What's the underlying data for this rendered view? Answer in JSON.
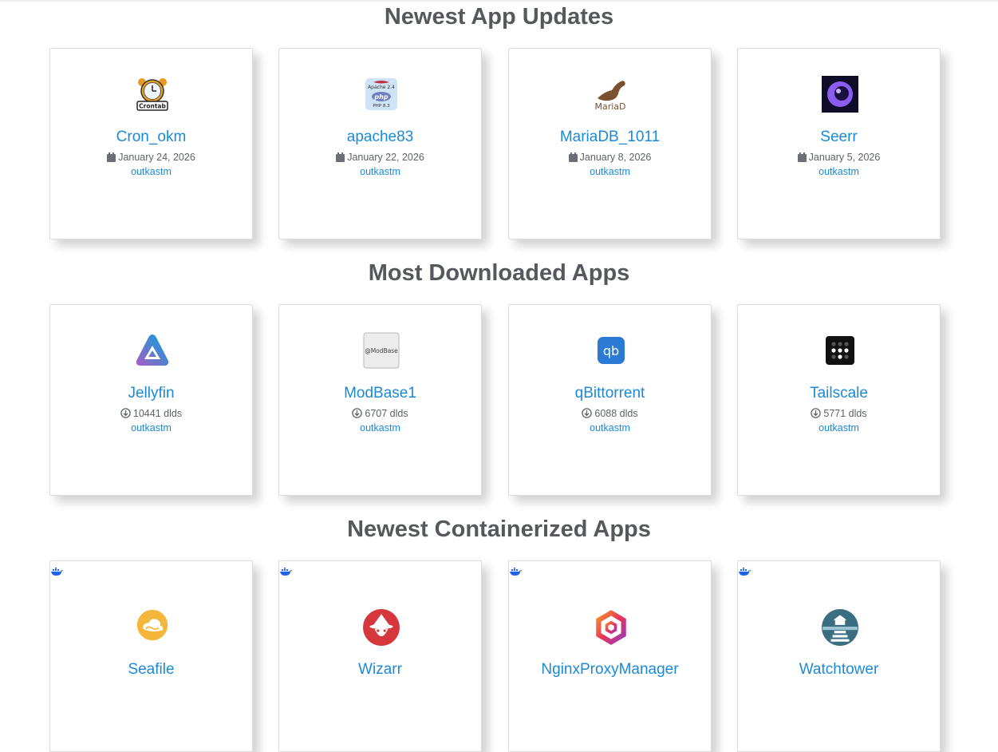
{
  "sections": [
    {
      "title": "Newest App Updates",
      "items": [
        {
          "name": "Cron_okm",
          "date": "January 24, 2026",
          "author": "outkastm",
          "icon": "alarm-clock-crontab-icon"
        },
        {
          "name": "apache83",
          "date": "January 22, 2026",
          "author": "outkastm",
          "icon": "apache-php-icon"
        },
        {
          "name": "MariaDB_1011",
          "date": "January 8, 2026",
          "author": "outkastm",
          "icon": "mariadb-seal-icon"
        },
        {
          "name": "Seerr",
          "date": "January 5, 2026",
          "author": "outkastm",
          "icon": "seerr-eye-icon"
        }
      ]
    },
    {
      "title": "Most Downloaded Apps",
      "items": [
        {
          "name": "Jellyfin",
          "downloads": "10441 dlds",
          "author": "outkastm",
          "icon": "jellyfin-triangle-icon"
        },
        {
          "name": "ModBase1",
          "downloads": "6707 dlds",
          "author": "outkastm",
          "icon": "modbase-icon"
        },
        {
          "name": "qBittorrent",
          "downloads": "6088 dlds",
          "author": "outkastm",
          "icon": "qbittorrent-icon"
        },
        {
          "name": "Tailscale",
          "downloads": "5771 dlds",
          "author": "outkastm",
          "icon": "tailscale-dots-icon"
        }
      ]
    },
    {
      "title": "Newest Containerized Apps",
      "items": [
        {
          "name": "Seafile",
          "icon": "seafile-cloud-icon"
        },
        {
          "name": "Wizarr",
          "icon": "wizard-icon"
        },
        {
          "name": "NginxProxyManager",
          "icon": "nginx-hexagon-icon"
        },
        {
          "name": "Watchtower",
          "icon": "watchtower-icon"
        }
      ]
    }
  ],
  "colors": {
    "link": "#1a8ad8",
    "title": "#55585d",
    "muted": "#5e6268"
  }
}
